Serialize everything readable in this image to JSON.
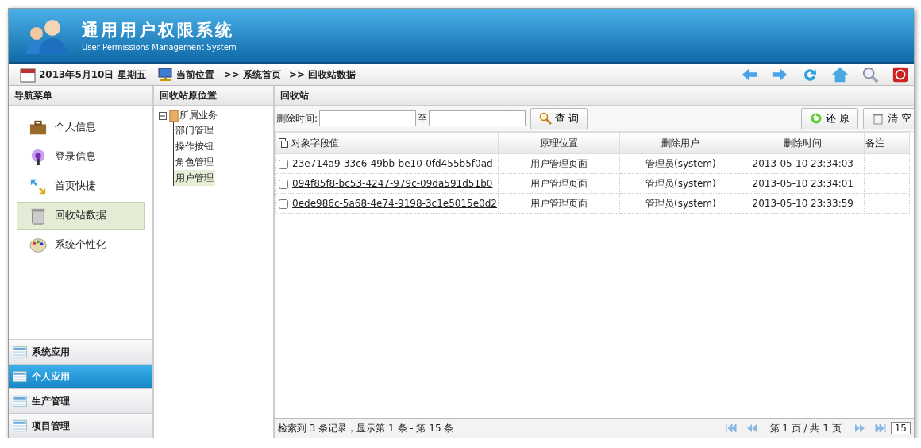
{
  "header": {
    "title": "通用用户权限系统",
    "subtitle": "User Permissions Management System"
  },
  "toolbar": {
    "date": "2013年5月10日 星期五",
    "location_label": "当前位置",
    "breadcrumbs": [
      ">> 系统首页",
      ">> 回收站数据"
    ]
  },
  "nav_menu": {
    "title": "导航菜单",
    "items": [
      {
        "label": "个人信息",
        "selected": false
      },
      {
        "label": "登录信息",
        "selected": false
      },
      {
        "label": "首页快捷",
        "selected": false
      },
      {
        "label": "回收站数据",
        "selected": true
      },
      {
        "label": "系统个性化",
        "selected": false
      }
    ]
  },
  "accordion": [
    {
      "label": "系统应用",
      "selected": false
    },
    {
      "label": "个人应用",
      "selected": true
    },
    {
      "label": "生产管理",
      "selected": false
    },
    {
      "label": "项目管理",
      "selected": false
    }
  ],
  "tree": {
    "title": "回收站原位置",
    "root": {
      "label": "所属业务",
      "expanded": true,
      "children": [
        {
          "label": "部门管理",
          "selected": false
        },
        {
          "label": "操作按钮",
          "selected": false
        },
        {
          "label": "角色管理",
          "selected": false
        },
        {
          "label": "用户管理",
          "selected": true
        }
      ]
    }
  },
  "recycle": {
    "title": "回收站",
    "filter": {
      "label": "删除时间:",
      "to_label": "至",
      "query_button": "查 询"
    },
    "buttons": [
      "还 原",
      "清 空"
    ],
    "table": {
      "columns": [
        "对象字段值",
        "原理位置",
        "删除用户",
        "删除时间",
        "备注"
      ],
      "rows": [
        {
          "checked": false,
          "cells": [
            "23e714a9-33c6-49bb-be10-0fd455b5f0ad",
            "用户管理页面",
            "管理员(system)",
            "2013-05-10 23:34:03"
          ]
        },
        {
          "checked": false,
          "cells": [
            "094f85f8-bc53-4247-979c-09da591d51b0",
            "用户管理页面",
            "管理员(system)",
            "2013-05-10 23:34:01"
          ]
        },
        {
          "checked": false,
          "cells": [
            "0ede986c-5a68-4e74-9198-3c1e5015e0d2",
            "用户管理页面",
            "管理员(system)",
            "2013-05-10 23:33:59"
          ]
        }
      ]
    },
    "status": "检索到 3 条记录，显示第 1 条 - 第 15 条",
    "pager": {
      "page_info": "第 1 页 / 共 1 页",
      "page_size": "15"
    }
  }
}
